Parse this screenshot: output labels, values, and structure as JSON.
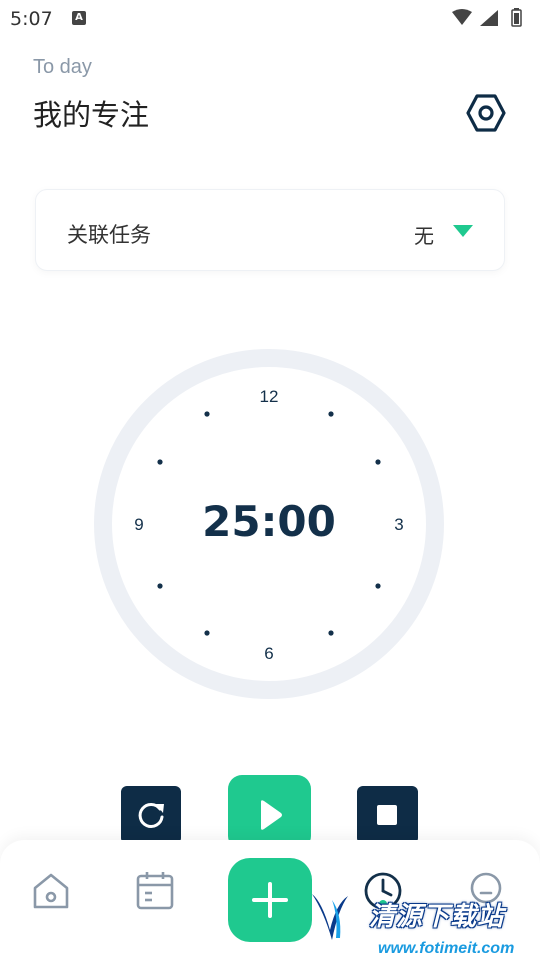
{
  "status_bar": {
    "time": "5:07",
    "notification_letter": "A"
  },
  "header": {
    "subtitle": "To day",
    "title": "我的专注"
  },
  "task": {
    "label": "关联任务",
    "value": "无"
  },
  "timer": {
    "display": "25:00",
    "dial_numbers": {
      "top": "12",
      "right": "3",
      "bottom": "6",
      "left": "9"
    }
  },
  "watermark": {
    "brand": "清源下载站",
    "url": "www.fotimeit.com"
  },
  "colors": {
    "accent": "#1fc98f",
    "dark": "#0e2c46",
    "ring": "#edf0f5"
  },
  "icons": [
    "wifi-icon",
    "signal-icon",
    "battery-icon",
    "settings-hex-icon",
    "dropdown-triangle-icon",
    "reset-icon",
    "play-icon",
    "stop-icon",
    "home-icon",
    "calendar-icon",
    "plus-icon",
    "timer-icon",
    "user-icon"
  ]
}
